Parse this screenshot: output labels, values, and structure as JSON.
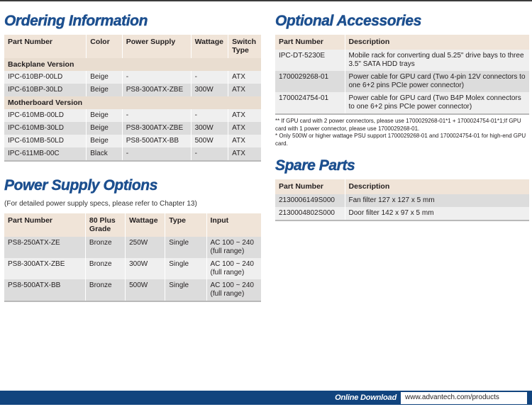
{
  "page": {
    "footer": {
      "label": "Online Download",
      "url": "www.advantech.com/products"
    }
  },
  "ordering": {
    "title": "Ordering Information",
    "headers": [
      "Part Number",
      "Color",
      "Power Supply",
      "Wattage",
      "Switch Type"
    ],
    "groups": [
      {
        "label": "Backplane Version",
        "rows": [
          [
            "IPC-610BP-00LD",
            "Beige",
            "-",
            "-",
            "ATX"
          ],
          [
            "IPC-610BP-30LD",
            "Beige",
            "PS8-300ATX-ZBE",
            "300W",
            "ATX"
          ]
        ]
      },
      {
        "label": "Motherboard Version",
        "rows": [
          [
            "IPC-610MB-00LD",
            "Beige",
            "-",
            "-",
            "ATX"
          ],
          [
            "IPC-610MB-30LD",
            "Beige",
            "PS8-300ATX-ZBE",
            "300W",
            "ATX"
          ],
          [
            "IPC-610MB-50LD",
            "Beige",
            "PS8-500ATX-BB",
            "500W",
            "ATX"
          ],
          [
            "IPC-611MB-00C",
            "Black",
            "-",
            "-",
            "ATX"
          ]
        ]
      }
    ]
  },
  "power_supply": {
    "title": "Power Supply Options",
    "subtitle": "(For detailed power supply specs, please refer to Chapter 13)",
    "headers": [
      "Part Number",
      "80 Plus Grade",
      "Wattage",
      "Type",
      "Input"
    ],
    "rows": [
      [
        "PS8-250ATX-ZE",
        "Bronze",
        "250W",
        "Single",
        "AC 100 ~ 240 (full range)"
      ],
      [
        "PS8-300ATX-ZBE",
        "Bronze",
        "300W",
        "Single",
        "AC 100 ~ 240 (full range)"
      ],
      [
        "PS8-500ATX-BB",
        "Bronze",
        "500W",
        "Single",
        "AC 100 ~ 240 (full range)"
      ]
    ]
  },
  "optional_accessories": {
    "title": "Optional Accessories",
    "headers": [
      "Part Number",
      "Description"
    ],
    "rows": [
      [
        "IPC-DT-5230E",
        "Mobile rack for converting dual 5.25\" drive bays to three 3.5\" SATA HDD trays"
      ],
      [
        "1700029268-01",
        "Power cable for GPU card (Two 4-pin 12V connectors to one 6+2 pins PCIe power connector)"
      ],
      [
        "1700024754-01",
        "Power cable for GPU card (Two B4P Molex connectors to one 6+2 pins PCIe power connector)"
      ]
    ],
    "footnotes": [
      "** If GPU card with 2 power connectors, please use 1700029268-01*1 + 1700024754-01*1;If GPU card with 1 power connector, please use 1700029268-01.",
      "* Only 500W or higher wattage PSU support 1700029268-01 and 1700024754-01 for high-end GPU card."
    ]
  },
  "spare_parts": {
    "title": "Spare Parts",
    "headers": [
      "Part Number",
      "Description"
    ],
    "rows": [
      [
        "2130006149S000",
        "Fan filter 127 x 127 x 5 mm"
      ],
      [
        "2130004802S000",
        "Door filter 142 x 97 x 5 mm"
      ]
    ]
  },
  "colors": {
    "title_blue": "#1c4f8f",
    "header_beige": "#f0e4d8",
    "group_beige": "#e9ddd0",
    "row_odd": "#dcdcdc",
    "row_even": "#efefef",
    "footer_blue": "#11447e"
  }
}
